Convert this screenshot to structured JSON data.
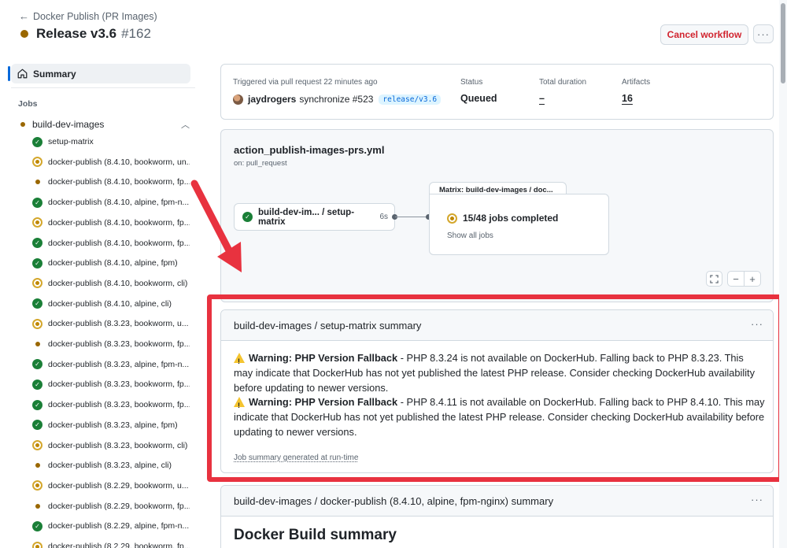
{
  "header": {
    "back_label": "Docker Publish (PR Images)",
    "title": "Release v3.6",
    "run_number": "#162",
    "cancel_label": "Cancel workflow",
    "more_label": "···"
  },
  "sidebar": {
    "summary_label": "Summary",
    "jobs_heading": "Jobs",
    "group_label": "build-dev-images",
    "jobs": [
      {
        "label": "setup-matrix",
        "status": "success"
      },
      {
        "label": "docker-publish (8.4.10, bookworm, un...",
        "status": "in_progress"
      },
      {
        "label": "docker-publish (8.4.10, bookworm, fp...",
        "status": "queued"
      },
      {
        "label": "docker-publish (8.4.10, alpine, fpm-n...",
        "status": "success"
      },
      {
        "label": "docker-publish (8.4.10, bookworm, fp...",
        "status": "in_progress"
      },
      {
        "label": "docker-publish (8.4.10, bookworm, fp...",
        "status": "success"
      },
      {
        "label": "docker-publish (8.4.10, alpine, fpm)",
        "status": "success"
      },
      {
        "label": "docker-publish (8.4.10, bookworm, cli)",
        "status": "in_progress"
      },
      {
        "label": "docker-publish (8.4.10, alpine, cli)",
        "status": "success"
      },
      {
        "label": "docker-publish (8.3.23, bookworm, u...",
        "status": "in_progress"
      },
      {
        "label": "docker-publish (8.3.23, bookworm, fp...",
        "status": "queued"
      },
      {
        "label": "docker-publish (8.3.23, alpine, fpm-n...",
        "status": "success"
      },
      {
        "label": "docker-publish (8.3.23, bookworm, fp...",
        "status": "success"
      },
      {
        "label": "docker-publish (8.3.23, bookworm, fp...",
        "status": "success"
      },
      {
        "label": "docker-publish (8.3.23, alpine, fpm)",
        "status": "success"
      },
      {
        "label": "docker-publish (8.3.23, bookworm, cli)",
        "status": "in_progress"
      },
      {
        "label": "docker-publish (8.3.23, alpine, cli)",
        "status": "queued"
      },
      {
        "label": "docker-publish (8.2.29, bookworm, u...",
        "status": "in_progress"
      },
      {
        "label": "docker-publish (8.2.29, bookworm, fp...",
        "status": "queued"
      },
      {
        "label": "docker-publish (8.2.29, alpine, fpm-n...",
        "status": "success"
      },
      {
        "label": "docker-publish (8.2.29, bookworm, fp...",
        "status": "in_progress"
      }
    ]
  },
  "run_info": {
    "trigger_text": "Triggered via pull request 22 minutes ago",
    "actor": "jaydrogers",
    "action": "synchronize #523",
    "branch": "release/v3.6",
    "status_label": "Status",
    "status_value": "Queued",
    "duration_label": "Total duration",
    "duration_value": "–",
    "artifacts_label": "Artifacts",
    "artifacts_value": "16"
  },
  "graph": {
    "workflow_file": "action_publish-images-prs.yml",
    "on_event": "on: pull_request",
    "node_label": "build-dev-im... / setup-matrix",
    "node_duration": "6s",
    "matrix_title": "Matrix: build-dev-images / doc...",
    "matrix_status": "15/48 jobs completed",
    "matrix_link": "Show all jobs",
    "zoom_out": "−",
    "zoom_in": "+"
  },
  "summary1": {
    "title": "build-dev-images / setup-matrix summary",
    "warnings": [
      {
        "heading": "Warning: PHP Version Fallback",
        "text": " - PHP 8.3.24 is not available on DockerHub. Falling back to PHP 8.3.23. This may indicate that DockerHub has not yet published the latest PHP release. Consider checking DockerHub availability before updating to newer versions."
      },
      {
        "heading": "Warning: PHP Version Fallback",
        "text": " - PHP 8.4.11 is not available on DockerHub. Falling back to PHP 8.4.10. This may indicate that DockerHub has not yet published the latest PHP release. Consider checking DockerHub availability before updating to newer versions."
      }
    ],
    "footer": "Job summary generated at run-time"
  },
  "summary2": {
    "title": "build-dev-images / docker-publish (8.4.10, alpine, fpm-nginx) summary",
    "heading": "Docker Build summary"
  },
  "colors": {
    "success": "#1a7f37",
    "in_progress": "#d4a72c",
    "queued": "#9a6700",
    "danger": "#d1242f",
    "highlight_frame": "#e8323f",
    "accent": "#0969da"
  }
}
